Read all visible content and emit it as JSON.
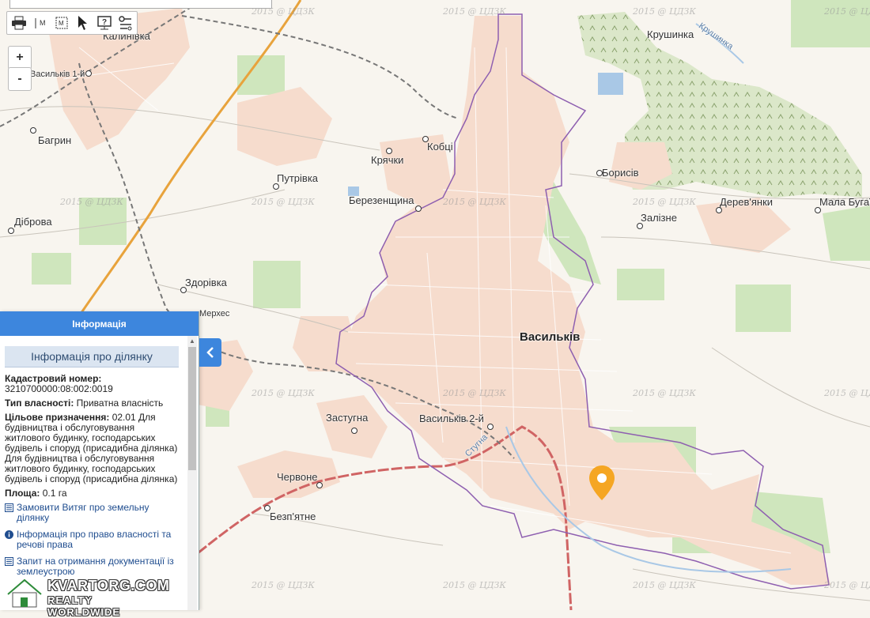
{
  "map": {
    "places": [
      {
        "name": "Калинівка"
      },
      {
        "name": "Васильків 1-й"
      },
      {
        "name": "Багрин"
      },
      {
        "name": "Діброва"
      },
      {
        "name": "Путрівка"
      },
      {
        "name": "Кобці"
      },
      {
        "name": "Крячки"
      },
      {
        "name": "Березенщина"
      },
      {
        "name": "Здорівка"
      },
      {
        "name": "Мерхес"
      },
      {
        "name": "Крушинка"
      },
      {
        "name": "Борисів"
      },
      {
        "name": "Залізне"
      },
      {
        "name": "Дерев'янки"
      },
      {
        "name": "Мала Бугаївка"
      },
      {
        "name": "Васильків"
      },
      {
        "name": "Застугна"
      },
      {
        "name": "Васильків 2-й"
      },
      {
        "name": "Червоне"
      },
      {
        "name": "Безп'ятне"
      }
    ],
    "river_labels": [
      "Крушинка",
      "Стугна"
    ],
    "watermark": "2015 @ ЦДЗК",
    "colors": {
      "settlement": "#f6dccd",
      "forest": "#c9e3b5",
      "orchard": "#d9e6c6",
      "water": "#a9c8e6",
      "boundary": "#8e5fb0",
      "railway": "#777777",
      "highway": "#e8a33c",
      "road": "#d06464",
      "marker": "#f5a623"
    }
  },
  "toolbar": {
    "tools": [
      "printer-icon",
      "measure-distance-icon",
      "measure-area-icon",
      "cursor-icon",
      "help-icon",
      "layers-icon"
    ]
  },
  "zoom": {
    "in": "+",
    "out": "-"
  },
  "panel": {
    "title": "Інформація",
    "subtitle": "Інформація про ділянку",
    "cadastral_label": "Кадастровий номер:",
    "cadastral_value": "3210700000:08:002:0019",
    "ownership_label": "Тип власності:",
    "ownership_value": "Приватна власність",
    "purpose_label": "Цільове призначення:",
    "purpose_value": "02.01 Для будівництва і обслуговування житлового будинку, господарських будівель і споруд (присадибна ділянка) Для будівництва і обслуговування житлового будинку, господарських будівель і споруд (присадибна ділянка)",
    "area_label": "Площа:",
    "area_value": "0.1 га",
    "links": [
      "Замовити Витяг про земельну ділянку",
      "Інформація про право власності та речові права",
      "Запит на отримання документації із землеустрою"
    ]
  },
  "branding": {
    "line1": "KVARTORG.COM",
    "line2": "REALTY WORLDWIDE"
  }
}
